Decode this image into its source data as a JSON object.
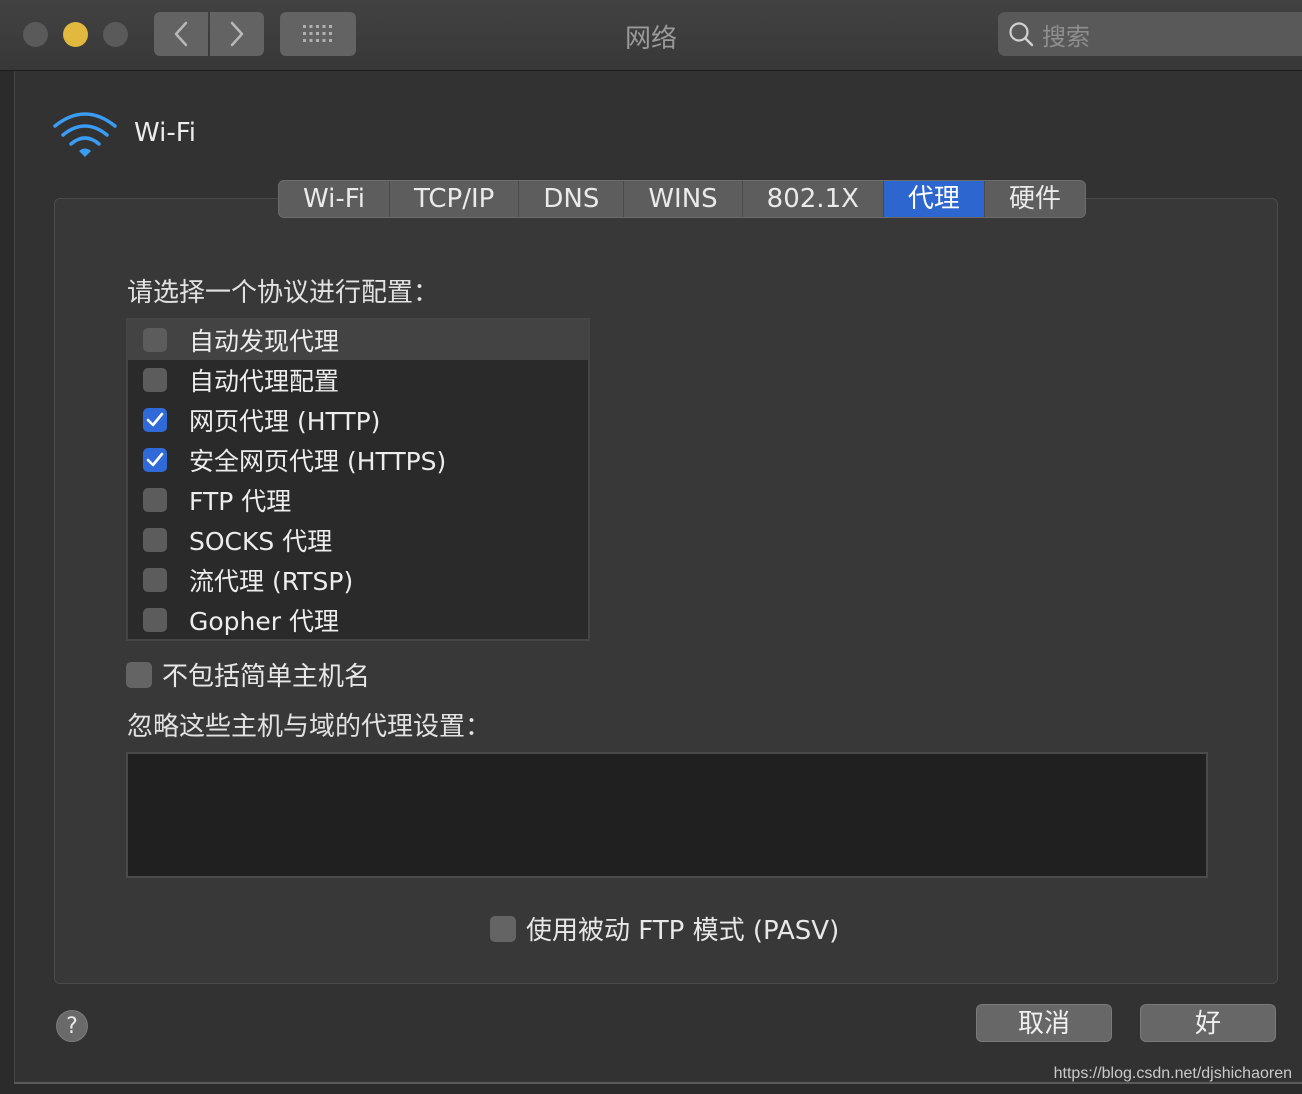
{
  "window": {
    "title": "网络",
    "search_placeholder": "搜索"
  },
  "service": {
    "name": "Wi-Fi",
    "accent_color": "#3b9cf3"
  },
  "tabs": [
    {
      "label": "Wi-Fi",
      "active": false
    },
    {
      "label": "TCP/IP",
      "active": false
    },
    {
      "label": "DNS",
      "active": false
    },
    {
      "label": "WINS",
      "active": false
    },
    {
      "label": "802.1X",
      "active": false
    },
    {
      "label": "代理",
      "active": true
    },
    {
      "label": "硬件",
      "active": false
    }
  ],
  "proxy": {
    "select_protocol_label": "请选择一个协议进行配置：",
    "protocols": [
      {
        "label": "自动发现代理",
        "checked": false,
        "selected": true
      },
      {
        "label": "自动代理配置",
        "checked": false,
        "selected": false
      },
      {
        "label": "网页代理 (HTTP)",
        "checked": true,
        "selected": false
      },
      {
        "label": "安全网页代理 (HTTPS)",
        "checked": true,
        "selected": false
      },
      {
        "label": "FTP 代理",
        "checked": false,
        "selected": false
      },
      {
        "label": "SOCKS 代理",
        "checked": false,
        "selected": false
      },
      {
        "label": "流代理 (RTSP)",
        "checked": false,
        "selected": false
      },
      {
        "label": "Gopher 代理",
        "checked": false,
        "selected": false
      }
    ],
    "exclude_simple_hostnames": {
      "label": "不包括简单主机名",
      "checked": false
    },
    "bypass_label": "忽略这些主机与域的代理设置：",
    "bypass_value": "",
    "passive_ftp": {
      "label": "使用被动 FTP 模式 (PASV)",
      "checked": false
    }
  },
  "footer": {
    "help": "?",
    "cancel": "取消",
    "ok": "好"
  },
  "watermark": "https://blog.csdn.net/djshichaoren",
  "colors": {
    "accent_blue": "#2e66cf",
    "traffic_yellow": "#e2b93f"
  }
}
